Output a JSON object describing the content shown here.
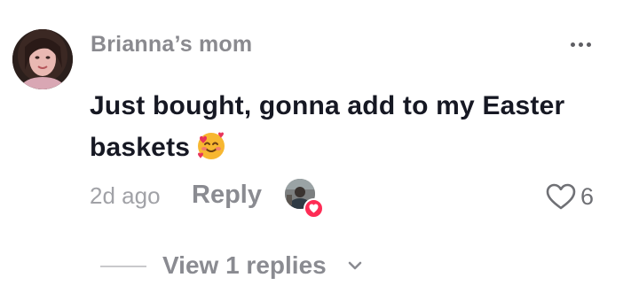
{
  "comment": {
    "username": "Brianna’s mom",
    "text": "Just bought, gonna add to my Easter baskets",
    "emoji": "smiling-face-with-hearts",
    "timestamp": "2d ago",
    "reply_label": "Reply",
    "creator_liked": true,
    "like_count": "6",
    "more_icon": "more-horizontal-icon"
  },
  "replies": {
    "label": "View 1 replies",
    "icon": "chevron-down-icon"
  },
  "colors": {
    "username": "#8a8a8f",
    "text": "#161823",
    "muted": "#a1a2a7",
    "reply": "#8a8b91",
    "like_badge": "#fe2c55"
  }
}
